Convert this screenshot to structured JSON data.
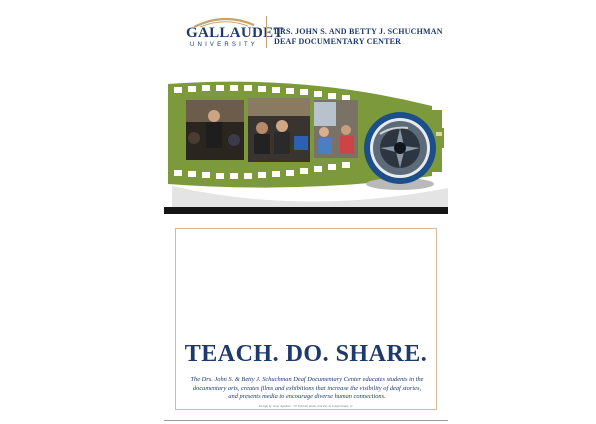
{
  "header": {
    "university_name": "GALLAUDET",
    "university_sub": "UNIVERSITY",
    "center_line1": "DRS. JOHN S. AND BETTY J. SCHUCHMAN",
    "center_line2": "DEAF DOCUMENTARY CENTER"
  },
  "banner": {
    "image": "film-strip-photo-collage",
    "lens_icon": "camera-aperture-icon",
    "colors": {
      "film": "#7c9a3c",
      "lens_ring": "#1c4f8a"
    }
  },
  "card": {
    "tagline": "TEACH. DO. SHARE.",
    "mission_line1": "The Drs. John S. & Betty J. Schuchman Deaf Documentary Center educates students in the",
    "mission_line2": "documentary arts, creates films and exhibitions that increase the visibility of deaf stories,",
    "mission_line3": "and presents media to encourage diverse human connections.",
    "credit": "Design by Jessy Agudelo · '07 Portrait photo courtesy of Joseph Isaac, Jr."
  },
  "colors": {
    "brand_blue": "#1d3a6b",
    "accent_gold": "#c7a36a",
    "card_border": "#d9b896"
  }
}
